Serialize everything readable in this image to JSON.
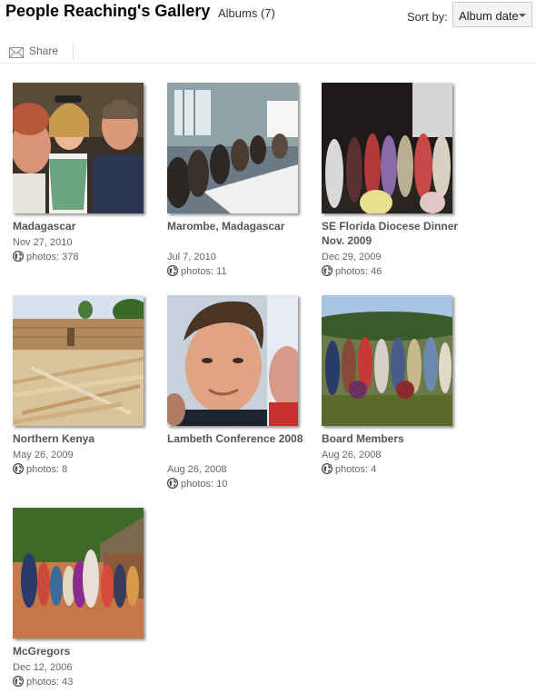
{
  "header": {
    "title": "People Reaching's Gallery",
    "albums_count": "Albums (7)",
    "sort_label": "Sort by:",
    "sort_value": "Album date"
  },
  "toolbar": {
    "share_label": "Share",
    "share_icon": "envelope-icon"
  },
  "albums": [
    {
      "name": "Madagascar",
      "date": "Nov 27, 2010",
      "photos": "photos: 378",
      "visibility_icon": "globe-icon"
    },
    {
      "name": "Marombe, Madagascar",
      "date": "Jul 7, 2010",
      "photos": "photos: 11",
      "visibility_icon": "globe-icon"
    },
    {
      "name": "SE Florida Diocese Dinner Nov. 2009",
      "date": "Dec 29, 2009",
      "photos": "photos: 46",
      "visibility_icon": "globe-icon"
    },
    {
      "name": "Northern Kenya",
      "date": "May 26, 2009",
      "photos": "photos: 8",
      "visibility_icon": "globe-icon"
    },
    {
      "name": "Lambeth Conference 2008",
      "date": "Aug 26, 2008",
      "photos": "photos: 10",
      "visibility_icon": "globe-icon"
    },
    {
      "name": "Board Members",
      "date": "Aug 26, 2008",
      "photos": "photos: 4",
      "visibility_icon": "globe-icon"
    },
    {
      "name": "McGregors",
      "date": "Dec 12, 2006",
      "photos": "photos: 43",
      "visibility_icon": "globe-icon"
    }
  ]
}
